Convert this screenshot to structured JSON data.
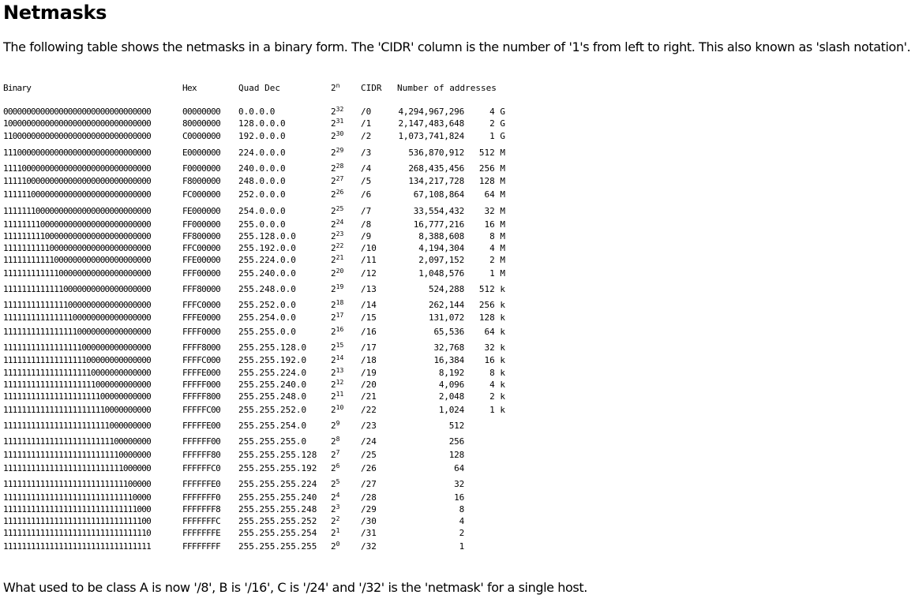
{
  "title": "Netmasks",
  "intro": "The following table shows the netmasks in a binary form. The 'CIDR' column is the number of '1's from left to right. This also known as 'slash notation'.",
  "outro": "What used to be class A is now '/8', B is '/16', C is '/24' and '/32' is the 'netmask' for a single host.",
  "table": {
    "headers": {
      "binary": "Binary",
      "hex": "Hex",
      "quad": "Quad Dec",
      "pow_base": "2",
      "pow_exp": "n",
      "cidr": "CIDR",
      "addresses": "Number of addresses"
    },
    "rows": [
      {
        "bin": "00000000000000000000000000000000",
        "hex": "00000000",
        "quad": "0.0.0.0",
        "base": "2",
        "exp": "32",
        "cidr": "/0",
        "num": "4,294,967,296",
        "size": "4 G"
      },
      {
        "bin": "10000000000000000000000000000000",
        "hex": "80000000",
        "quad": "128.0.0.0",
        "base": "2",
        "exp": "31",
        "cidr": "/1",
        "num": "2,147,483,648",
        "size": "2 G"
      },
      {
        "bin": "11000000000000000000000000000000",
        "hex": "C0000000",
        "quad": "192.0.0.0",
        "base": "2",
        "exp": "30",
        "cidr": "/2",
        "num": "1,073,741,824",
        "size": "1 G"
      },
      {
        "bin": "11100000000000000000000000000000",
        "hex": "E0000000",
        "quad": "224.0.0.0",
        "base": "2",
        "exp": "29",
        "cidr": "/3",
        "num": "536,870,912",
        "size": "512 M"
      },
      {
        "bin": "11110000000000000000000000000000",
        "hex": "F0000000",
        "quad": "240.0.0.0",
        "base": "2",
        "exp": "28",
        "cidr": "/4",
        "num": "268,435,456",
        "size": "256 M"
      },
      {
        "bin": "11111000000000000000000000000000",
        "hex": "F8000000",
        "quad": "248.0.0.0",
        "base": "2",
        "exp": "27",
        "cidr": "/5",
        "num": "134,217,728",
        "size": "128 M"
      },
      {
        "bin": "11111100000000000000000000000000",
        "hex": "FC000000",
        "quad": "252.0.0.0",
        "base": "2",
        "exp": "26",
        "cidr": "/6",
        "num": "67,108,864",
        "size": "64 M"
      },
      {
        "bin": "11111110000000000000000000000000",
        "hex": "FE000000",
        "quad": "254.0.0.0",
        "base": "2",
        "exp": "25",
        "cidr": "/7",
        "num": "33,554,432",
        "size": "32 M"
      },
      {
        "bin": "11111111000000000000000000000000",
        "hex": "FF000000",
        "quad": "255.0.0.0",
        "base": "2",
        "exp": "24",
        "cidr": "/8",
        "num": "16,777,216",
        "size": "16 M"
      },
      {
        "bin": "11111111100000000000000000000000",
        "hex": "FF800000",
        "quad": "255.128.0.0",
        "base": "2",
        "exp": "23",
        "cidr": "/9",
        "num": "8,388,608",
        "size": "8 M"
      },
      {
        "bin": "11111111110000000000000000000000",
        "hex": "FFC00000",
        "quad": "255.192.0.0",
        "base": "2",
        "exp": "22",
        "cidr": "/10",
        "num": "4,194,304",
        "size": "4 M"
      },
      {
        "bin": "11111111111000000000000000000000",
        "hex": "FFE00000",
        "quad": "255.224.0.0",
        "base": "2",
        "exp": "21",
        "cidr": "/11",
        "num": "2,097,152",
        "size": "2 M"
      },
      {
        "bin": "11111111111100000000000000000000",
        "hex": "FFF00000",
        "quad": "255.240.0.0",
        "base": "2",
        "exp": "20",
        "cidr": "/12",
        "num": "1,048,576",
        "size": "1 M"
      },
      {
        "bin": "11111111111110000000000000000000",
        "hex": "FFF80000",
        "quad": "255.248.0.0",
        "base": "2",
        "exp": "19",
        "cidr": "/13",
        "num": "524,288",
        "size": "512 k"
      },
      {
        "bin": "11111111111111000000000000000000",
        "hex": "FFFC0000",
        "quad": "255.252.0.0",
        "base": "2",
        "exp": "18",
        "cidr": "/14",
        "num": "262,144",
        "size": "256 k"
      },
      {
        "bin": "11111111111111100000000000000000",
        "hex": "FFFE0000",
        "quad": "255.254.0.0",
        "base": "2",
        "exp": "17",
        "cidr": "/15",
        "num": "131,072",
        "size": "128 k"
      },
      {
        "bin": "11111111111111110000000000000000",
        "hex": "FFFF0000",
        "quad": "255.255.0.0",
        "base": "2",
        "exp": "16",
        "cidr": "/16",
        "num": "65,536",
        "size": "64 k"
      },
      {
        "bin": "11111111111111111000000000000000",
        "hex": "FFFF8000",
        "quad": "255.255.128.0",
        "base": "2",
        "exp": "15",
        "cidr": "/17",
        "num": "32,768",
        "size": "32 k"
      },
      {
        "bin": "11111111111111111100000000000000",
        "hex": "FFFFC000",
        "quad": "255.255.192.0",
        "base": "2",
        "exp": "14",
        "cidr": "/18",
        "num": "16,384",
        "size": "16 k"
      },
      {
        "bin": "11111111111111111110000000000000",
        "hex": "FFFFE000",
        "quad": "255.255.224.0",
        "base": "2",
        "exp": "13",
        "cidr": "/19",
        "num": "8,192",
        "size": "8 k"
      },
      {
        "bin": "11111111111111111111000000000000",
        "hex": "FFFFF000",
        "quad": "255.255.240.0",
        "base": "2",
        "exp": "12",
        "cidr": "/20",
        "num": "4,096",
        "size": "4 k"
      },
      {
        "bin": "11111111111111111111100000000000",
        "hex": "FFFFF800",
        "quad": "255.255.248.0",
        "base": "2",
        "exp": "11",
        "cidr": "/21",
        "num": "2,048",
        "size": "2 k"
      },
      {
        "bin": "11111111111111111111110000000000",
        "hex": "FFFFFC00",
        "quad": "255.255.252.0",
        "base": "2",
        "exp": "10",
        "cidr": "/22",
        "num": "1,024",
        "size": "1 k"
      },
      {
        "bin": "11111111111111111111111000000000",
        "hex": "FFFFFE00",
        "quad": "255.255.254.0",
        "base": "2",
        "exp": "9",
        "cidr": "/23",
        "num": "512",
        "size": ""
      },
      {
        "bin": "11111111111111111111111100000000",
        "hex": "FFFFFF00",
        "quad": "255.255.255.0",
        "base": "2",
        "exp": "8",
        "cidr": "/24",
        "num": "256",
        "size": ""
      },
      {
        "bin": "11111111111111111111111110000000",
        "hex": "FFFFFF80",
        "quad": "255.255.255.128",
        "base": "2",
        "exp": "7",
        "cidr": "/25",
        "num": "128",
        "size": ""
      },
      {
        "bin": "11111111111111111111111111000000",
        "hex": "FFFFFFC0",
        "quad": "255.255.255.192",
        "base": "2",
        "exp": "6",
        "cidr": "/26",
        "num": "64",
        "size": ""
      },
      {
        "bin": "11111111111111111111111111100000",
        "hex": "FFFFFFE0",
        "quad": "255.255.255.224",
        "base": "2",
        "exp": "5",
        "cidr": "/27",
        "num": "32",
        "size": ""
      },
      {
        "bin": "11111111111111111111111111110000",
        "hex": "FFFFFFF0",
        "quad": "255.255.255.240",
        "base": "2",
        "exp": "4",
        "cidr": "/28",
        "num": "16",
        "size": ""
      },
      {
        "bin": "11111111111111111111111111111000",
        "hex": "FFFFFFF8",
        "quad": "255.255.255.248",
        "base": "2",
        "exp": "3",
        "cidr": "/29",
        "num": "8",
        "size": ""
      },
      {
        "bin": "11111111111111111111111111111100",
        "hex": "FFFFFFFC",
        "quad": "255.255.255.252",
        "base": "2",
        "exp": "2",
        "cidr": "/30",
        "num": "4",
        "size": ""
      },
      {
        "bin": "11111111111111111111111111111110",
        "hex": "FFFFFFFE",
        "quad": "255.255.255.254",
        "base": "2",
        "exp": "1",
        "cidr": "/31",
        "num": "2",
        "size": ""
      },
      {
        "bin": "11111111111111111111111111111111",
        "hex": "FFFFFFFF",
        "quad": "255.255.255.255",
        "base": "2",
        "exp": "0",
        "cidr": "/32",
        "num": "1",
        "size": ""
      }
    ]
  }
}
